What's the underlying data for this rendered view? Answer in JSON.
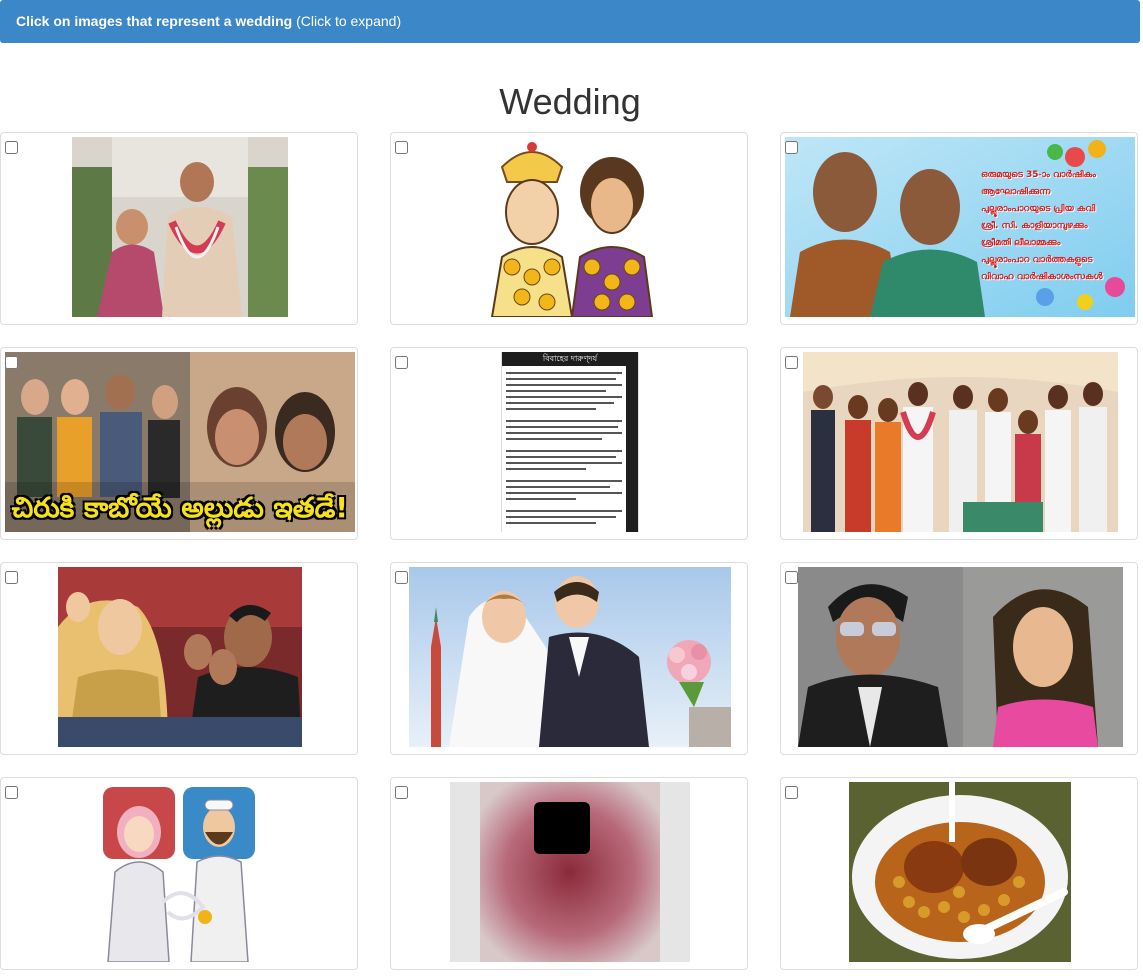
{
  "banner": {
    "bold_text": "Click on images that represent a wedding",
    "hint_text": " (Click to expand)"
  },
  "page": {
    "title": "Wedding"
  },
  "grid": {
    "items": [
      {
        "name": "wedding-couple-photo",
        "checked": false
      },
      {
        "name": "cartoon-bride-groom",
        "checked": false
      },
      {
        "name": "anniversary-poster",
        "checked": false,
        "caption_lines": [
          "ഒരുമയുടെ 35-ാം വാർഷികം",
          "ആഘോഷിക്കുന്ന",
          "പുല്ലൂരാംപാറയുടെ പ്രിയ കവി",
          "ശ്രീ. സി. കാളിയാമ്പുഴക്കും",
          "ശ്രീമതി ലീലാമ്മക്കും",
          "പുല്ലൂരാംപാറ വാർത്തകളുടെ",
          "വിവാഹ വാർഷികാശംസകൾ"
        ]
      },
      {
        "name": "telugu-movie-collage",
        "checked": false,
        "caption": "చిరుకి కాబోయే అల్లుడు ఇతడే!"
      },
      {
        "name": "phone-screenshot-text",
        "checked": false,
        "header": "বিবাহের দারুণ্দর্য"
      },
      {
        "name": "group-wedding-photo",
        "checked": false
      },
      {
        "name": "celebrities-clapping",
        "checked": false
      },
      {
        "name": "bride-groom-kiss",
        "checked": false
      },
      {
        "name": "actor-actress-split",
        "checked": false
      },
      {
        "name": "cartoon-muslim-couple",
        "checked": false
      },
      {
        "name": "blurred-image",
        "checked": false
      },
      {
        "name": "food-plate",
        "checked": false
      }
    ]
  }
}
